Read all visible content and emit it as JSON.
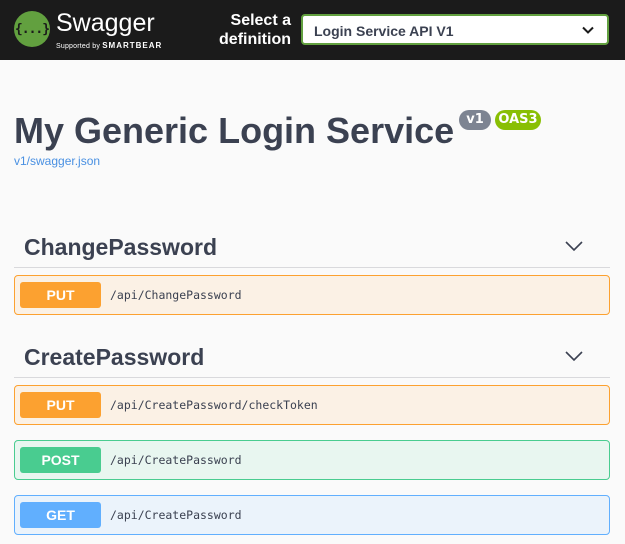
{
  "topbar": {
    "logo_glyph": "{...}",
    "brand": "Swagger",
    "brand_sub_prefix": "Supported by",
    "brand_sub_name": "SMARTBEAR",
    "select_label": "Select a definition",
    "definition_value": "Login Service API V1"
  },
  "info": {
    "title": "My Generic Login Service",
    "version_badge": "v1",
    "oas_badge": "OAS3",
    "spec_url": "v1/swagger.json"
  },
  "tags": [
    {
      "name": "ChangePassword",
      "operations": [
        {
          "method": "PUT",
          "path": "/api/ChangePassword"
        }
      ]
    },
    {
      "name": "CreatePassword",
      "operations": [
        {
          "method": "PUT",
          "path": "/api/CreatePassword/checkToken"
        },
        {
          "method": "POST",
          "path": "/api/CreatePassword"
        },
        {
          "method": "GET",
          "path": "/api/CreatePassword"
        }
      ]
    }
  ],
  "colors": {
    "put": "#fca130",
    "post": "#49cc90",
    "get": "#61affe",
    "topbar": "#1b1b1b",
    "accent": "#62a03f"
  },
  "icons": {
    "logo": "swagger-logo-icon",
    "select_chevron": "chevron-down-icon",
    "section_toggle": "chevron-down-icon"
  }
}
